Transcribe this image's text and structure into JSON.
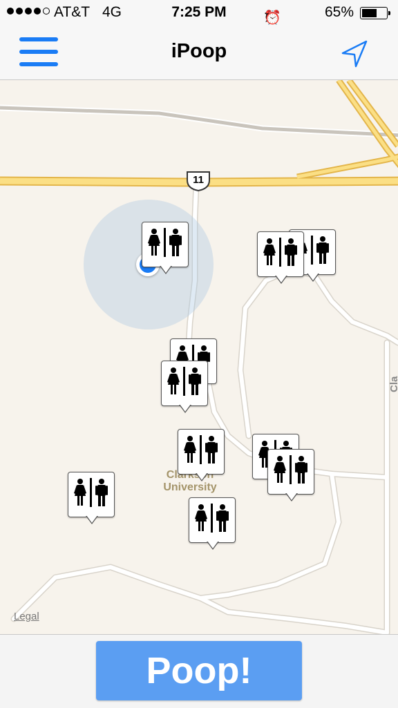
{
  "status_bar": {
    "carrier": "AT&T",
    "network": "4G",
    "time": "7:25 PM",
    "battery_percent": "65%",
    "battery_level": 0.65,
    "signal_bars": 4,
    "signal_total": 5,
    "icons": [
      "rotation-lock-icon",
      "location-arrow-icon",
      "alarm-icon"
    ]
  },
  "nav": {
    "title": "iPoop",
    "menu_icon": "hamburger-menu-icon",
    "locate_icon": "location-arrow-icon"
  },
  "map": {
    "route_shield": "11",
    "place_label": "Clarkson University",
    "street_label": "Cla",
    "legal_link": "Legal",
    "restroom_pin_icon": "restroom-icon",
    "restroom_pin_count": 11
  },
  "footer": {
    "action_button": "Poop!"
  },
  "colors": {
    "accent": "#1a7cf5",
    "button": "#5b9ef2",
    "map_background": "#f7f3ec",
    "highway": "#f8d36b"
  }
}
